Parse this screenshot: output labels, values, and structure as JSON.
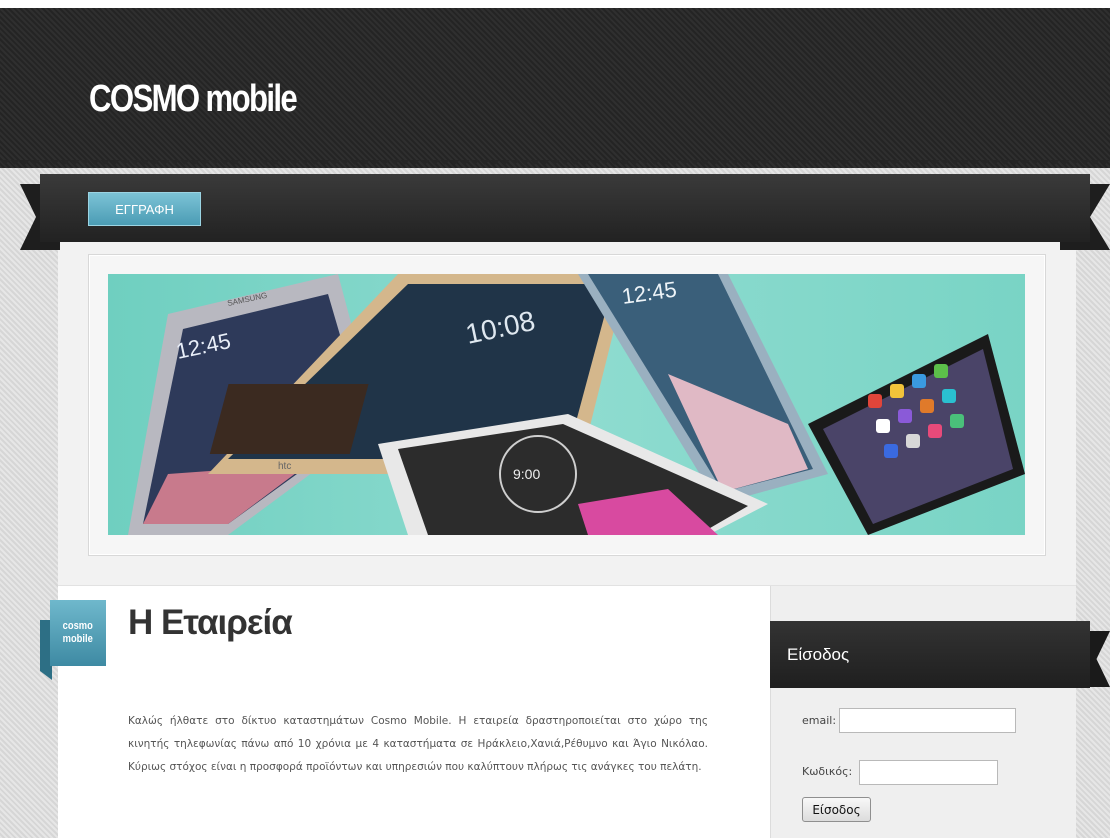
{
  "header": {
    "site_title": "COSMO mobile"
  },
  "nav": {
    "register_label": "ΕΓΓΡΑΦΗ"
  },
  "badge": {
    "line1": "cosmo",
    "line2": "mobile"
  },
  "main": {
    "heading": "Η Εταιρεία",
    "paragraph": "Καλώς ήλθατε στο δίκτυο καταστημάτων Cosmo Mobile. Η εταιρεία δραστηροποιείται στο χώρο της κινητής τηλεφωνίας πάνω από 10 χρόνια με 4 καταστήματα σε Ηράκλειο,Χανιά,Ρέθυμνο και Άγιο Νικόλαο. Κύριως στόχος είναι η προσφορά προϊόντων και υπηρεσιών που καλύπτουν πλήρως τις ανάγκες του πελάτη."
  },
  "login": {
    "title": "Είσοδος",
    "email_label": "email:",
    "email_value": "",
    "password_label": "Κωδικός:",
    "password_value": "",
    "submit_label": "Είσοδος"
  },
  "banner": {
    "clock_1": "12:45",
    "clock_2": "10:08",
    "clock_3": "12:45",
    "clock_4": "9:00",
    "htc_brand": "htc",
    "samsung_brand": "SAMSUNG"
  },
  "colors": {
    "header_bg": "#2a2a2a",
    "accent_blue": "#5aaec4",
    "banner_teal": "#7ad4c6"
  }
}
